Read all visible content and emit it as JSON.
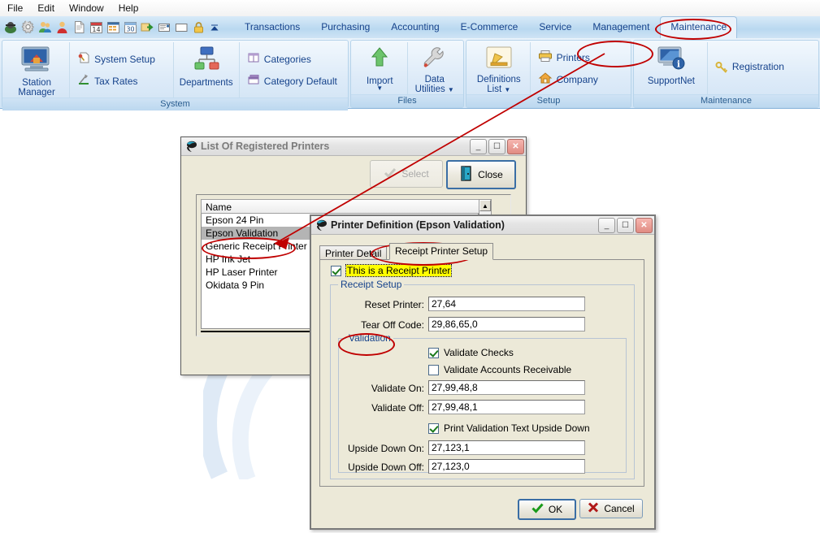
{
  "menubar": {
    "items": [
      {
        "label": "File"
      },
      {
        "label": "Edit"
      },
      {
        "label": "Window"
      },
      {
        "label": "Help"
      }
    ]
  },
  "quick_access_toolbar": {
    "icons": [
      {
        "name": "station-manager-icon"
      },
      {
        "name": "settings-gear-icon"
      },
      {
        "name": "users-group-icon"
      },
      {
        "name": "user-icon"
      },
      {
        "name": "document-icon"
      },
      {
        "name": "calendar-icon"
      },
      {
        "name": "spreadsheet-icon"
      },
      {
        "name": "calendar-30-icon"
      },
      {
        "name": "export-arrow-icon"
      },
      {
        "name": "email-icon"
      },
      {
        "name": "folder-icon"
      },
      {
        "name": "lock-icon"
      },
      {
        "name": "overflow-chevron-icon"
      }
    ]
  },
  "ribbon": {
    "tabs": [
      {
        "label": "Transactions",
        "active": false
      },
      {
        "label": "Purchasing",
        "active": false
      },
      {
        "label": "Accounting",
        "active": false
      },
      {
        "label": "E-Commerce",
        "active": false
      },
      {
        "label": "Service",
        "active": false
      },
      {
        "label": "Management",
        "active": false
      },
      {
        "label": "Maintenance",
        "active": true
      }
    ],
    "groups": [
      {
        "label": "System",
        "big_buttons": [
          {
            "label": "Station\nManager",
            "label_l1": "Station",
            "label_l2": "Manager",
            "icon": "station-manager-icon"
          },
          {
            "label": "Departments",
            "label_l1": "Departments",
            "label_l2": "",
            "icon": "departments-icon"
          }
        ],
        "small_buttons": [
          {
            "label": "System Setup",
            "icon": "system-setup-icon"
          },
          {
            "label": "Tax Rates",
            "icon": "tax-rates-icon"
          },
          {
            "label": "Categories",
            "icon": "categories-icon"
          },
          {
            "label": "Category Default",
            "icon": "category-default-icon"
          }
        ]
      },
      {
        "label": "Files",
        "big_buttons": [
          {
            "label_l1": "Import",
            "label_l2": "",
            "icon": "import-arrow-icon",
            "has_caret": true
          },
          {
            "label_l1": "Data",
            "label_l2": "Utilities",
            "icon": "data-utilities-wrench-icon",
            "has_caret": true
          }
        ],
        "small_buttons": []
      },
      {
        "label": "Setup",
        "big_buttons": [
          {
            "label_l1": "Definitions",
            "label_l2": "List",
            "icon": "definitions-list-pencil-icon",
            "has_caret": true
          }
        ],
        "small_buttons": [
          {
            "label": "Printers",
            "icon": "printer-icon"
          },
          {
            "label": "Company",
            "icon": "company-home-icon"
          }
        ]
      },
      {
        "label": "Maintenance",
        "big_buttons": [
          {
            "label_l1": "SupportNet",
            "label_l2": "",
            "icon": "supportnet-icon"
          }
        ],
        "small_buttons": [
          {
            "label": "Registration",
            "icon": "registration-key-icon"
          }
        ]
      }
    ]
  },
  "printers_window": {
    "title": "List Of Registered Printers",
    "buttons": {
      "select": "Select",
      "close": "Close"
    },
    "list": {
      "column_header": "Name",
      "rows": [
        {
          "label": "Epson 24 Pin",
          "selected": false
        },
        {
          "label": "Epson Validation",
          "selected": true
        },
        {
          "label": "Generic Receipt Printer",
          "selected": false
        },
        {
          "label": "HP Ink Jet",
          "selected": false
        },
        {
          "label": "HP Laser Printer",
          "selected": false
        },
        {
          "label": "Okidata 9 Pin",
          "selected": false
        }
      ]
    }
  },
  "printer_definition_dialog": {
    "title": "Printer Definition  (Epson Validation)",
    "tabs": [
      {
        "label": "Printer Detail",
        "selected": false
      },
      {
        "label": "Receipt Printer Setup",
        "selected": true
      }
    ],
    "is_receipt_printer": {
      "label": "This is a Receipt Printer",
      "checked": true
    },
    "receipt_setup": {
      "group_label": "Receipt Setup",
      "fields": [
        {
          "label": "Reset Printer:",
          "value": "27,64"
        },
        {
          "label": "Tear Off Code:",
          "value": "29,86,65,0"
        }
      ]
    },
    "validation": {
      "group_label": "Validation",
      "checkboxes": [
        {
          "label": "Validate Checks",
          "checked": true
        },
        {
          "label": "Validate Accounts Receivable",
          "checked": false
        }
      ],
      "fields_top": [
        {
          "label": "Validate On:",
          "value": "27,99,48,8"
        },
        {
          "label": "Validate Off:",
          "value": "27,99,48,1"
        }
      ],
      "upside_down_checkbox": {
        "label": "Print Validation Text Upside Down",
        "checked": true
      },
      "fields_bottom": [
        {
          "label": "Upside Down On:",
          "value": "27,123,1"
        },
        {
          "label": "Upside Down Off:",
          "value": "27,123,0"
        }
      ]
    },
    "footer_buttons": {
      "ok": "OK",
      "cancel": "Cancel"
    }
  },
  "annotations": {
    "accent_color": "#c00000",
    "highlight_color": "#ffff00",
    "ellipses": [
      {
        "name": "maintenance-tab-ellipse"
      },
      {
        "name": "printers-button-ellipse"
      },
      {
        "name": "epson-validation-row-ellipse"
      },
      {
        "name": "receipt-printer-setup-tab-ellipse"
      },
      {
        "name": "validation-group-ellipse"
      }
    ],
    "arrow": {
      "name": "printers-to-list-arrow"
    }
  }
}
